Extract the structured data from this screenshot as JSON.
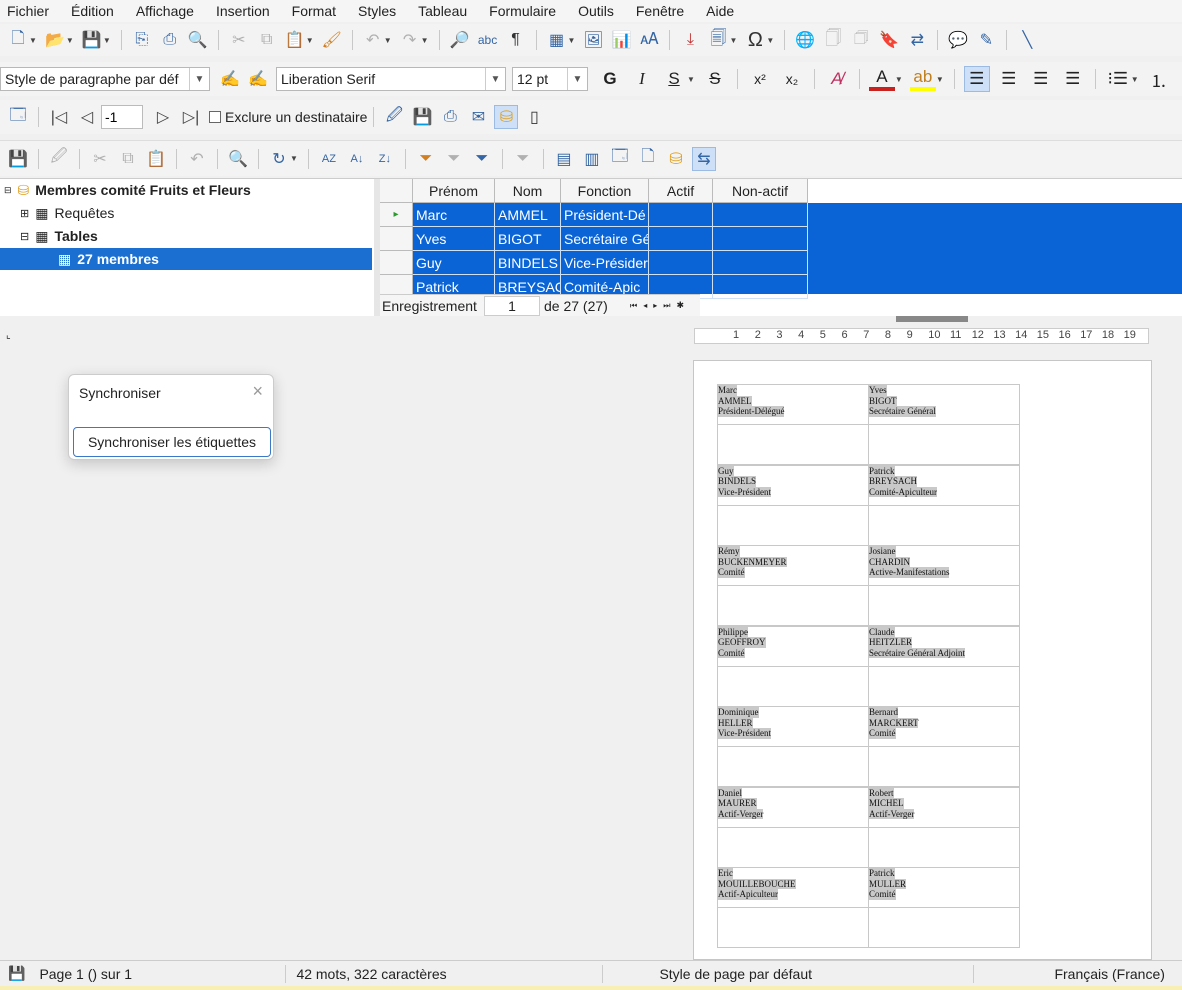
{
  "menu": [
    "Fichier",
    "Édition",
    "Affichage",
    "Insertion",
    "Format",
    "Styles",
    "Tableau",
    "Formulaire",
    "Outils",
    "Fenêtre",
    "Aide"
  ],
  "formatting": {
    "paragraph_style": "Style de paragraphe par déf",
    "font_name": "Liberation Serif",
    "font_size": "12 pt",
    "bold": "G",
    "italic": "I",
    "underline": "S",
    "strike": "S",
    "superscript": "x²",
    "subscript": "x₂",
    "font_color_letter": "A",
    "accent_color": "#c9211e",
    "highlight_color": "#ffff00"
  },
  "mailmerge": {
    "record_value": "-1",
    "exclude_label": "Exclure un destinataire"
  },
  "datasource": {
    "tree": {
      "root": "Membres comité Fruits et Fleurs",
      "queries": "Requêtes",
      "tables": "Tables",
      "selected_table": "27 membres"
    },
    "columns": [
      "Prénom",
      "Nom",
      "Fonction",
      "Actif",
      "Non-actif"
    ],
    "rows": [
      [
        "Marc",
        "AMMEL",
        "Président-Dé",
        "",
        ""
      ],
      [
        "Yves",
        "BIGOT",
        "Secrétaire Gé",
        "",
        ""
      ],
      [
        "Guy",
        "BINDELS",
        "Vice-Présider",
        "",
        ""
      ],
      [
        "Patrick",
        "BREYSAC",
        "Comité-Apic",
        "",
        ""
      ]
    ],
    "nav": {
      "label": "Enregistrement",
      "current": "1",
      "of": "de 27 (27)"
    }
  },
  "ruler_ticks": [
    "1",
    "2",
    "3",
    "4",
    "5",
    "6",
    "7",
    "8",
    "9",
    "10",
    "11",
    "12",
    "13",
    "14",
    "15",
    "16",
    "17",
    "18",
    "19"
  ],
  "labels": [
    [
      "Marc",
      "AMMEL",
      "Président-Délégué"
    ],
    [
      "Yves",
      "BIGOT",
      "Secrétaire Général"
    ],
    [
      "Guy",
      "BINDELS",
      "Vice-Président"
    ],
    [
      "Patrick",
      "BREYSACH",
      "Comité-Apiculteur"
    ],
    [
      "Rémy",
      "BUCKENMEYER",
      "Comité"
    ],
    [
      "Josiane",
      "CHARDIN",
      "Active-Manifestations"
    ],
    [
      "Philippe",
      "GEOFFROY",
      "Comité"
    ],
    [
      "Claude",
      "HEITZLER",
      "Secrétaire Général Adjoint"
    ],
    [
      "Dominique",
      "HELLER",
      "Vice-Président"
    ],
    [
      "Bernard",
      "MARCKERT",
      "Comité"
    ],
    [
      "Daniel",
      "MAURER",
      "Actif-Verger"
    ],
    [
      "Robert",
      "MICHEL",
      "Actif-Verger"
    ],
    [
      "Eric",
      "MOUILLEBOUCHE",
      "Actif-Apiculteur"
    ],
    [
      "Patrick",
      "MULLER",
      "Comité"
    ]
  ],
  "popup": {
    "title": "Synchroniser",
    "button": "Synchroniser les étiquettes"
  },
  "status": {
    "page": "Page 1 () sur 1",
    "words": "42 mots, 322 caractères",
    "page_style": "Style de page par défaut",
    "language": "Français (France)"
  },
  "colors": {
    "selection": "#0a64d6",
    "tree_selected": "#1a6fd1"
  }
}
